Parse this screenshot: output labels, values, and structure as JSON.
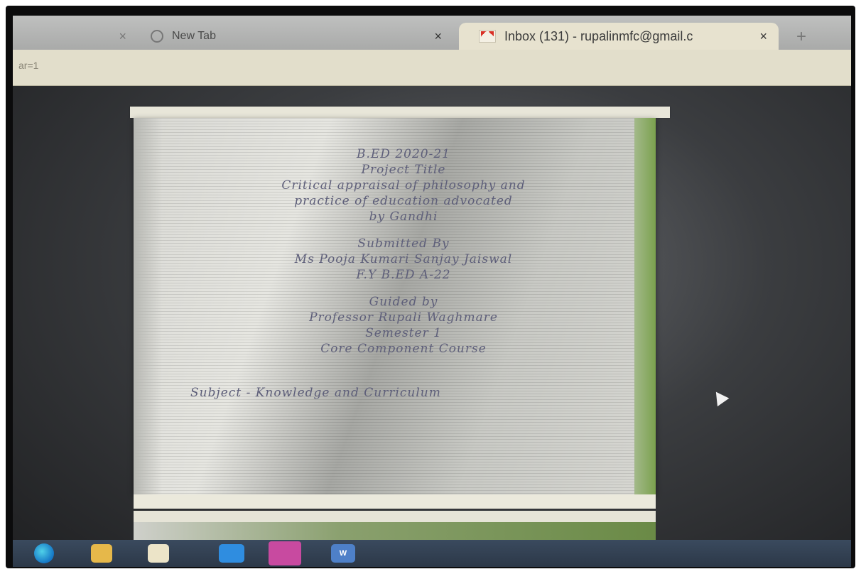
{
  "browser": {
    "tabs": [
      {
        "title": "",
        "close": "×"
      },
      {
        "title": "New Tab",
        "close": "×"
      },
      {
        "title": "Inbox (131) - rupalinmfc@gmail.c",
        "close": "×",
        "active": true
      }
    ],
    "new_tab": "+",
    "url_fragment": "ar=1"
  },
  "document": {
    "lines": [
      "B.ED 2020-21",
      "Project Title",
      "Critical appraisal of philosophy and",
      "practice of education advocated",
      "by Gandhi"
    ],
    "submitted": [
      "Submitted By",
      "Ms Pooja Kumari Sanjay Jaiswal",
      "F.Y B.ED A-22"
    ],
    "guided": [
      "Guided by",
      "Professor Rupali Waghmare",
      "Semester 1",
      "Core Component Course"
    ],
    "subject": "Subject - Knowledge and Curriculum"
  },
  "taskbar": {
    "word_label": "W"
  }
}
